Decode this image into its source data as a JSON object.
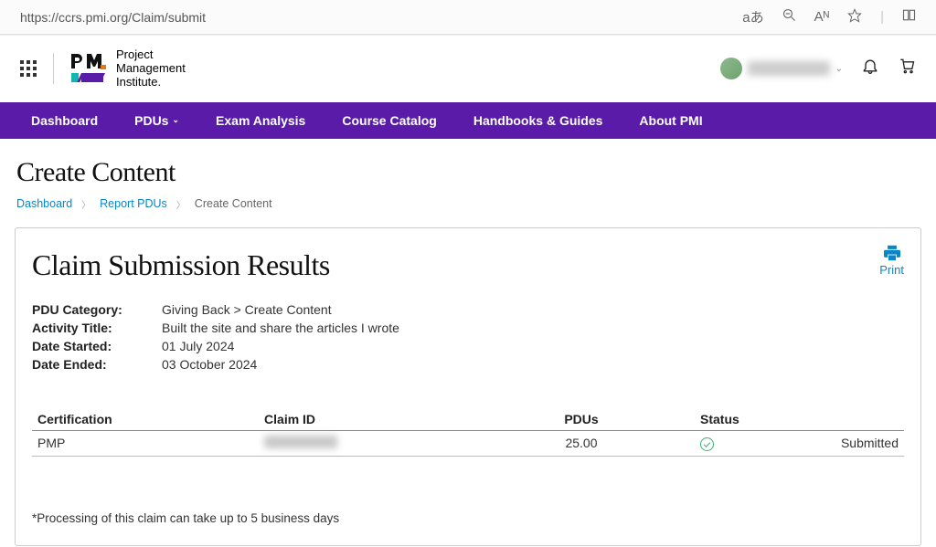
{
  "browser": {
    "url": "https://ccrs.pmi.org/Claim/submit",
    "icons": {
      "translate": "aあ",
      "zoom_out": "zoom-out",
      "text_size": "Aᴺ",
      "star": "star",
      "tab_actions": "tab-actions"
    }
  },
  "header": {
    "org_line1": "Project",
    "org_line2": "Management",
    "org_line3": "Institute.",
    "user_chevron": "⌄"
  },
  "nav": {
    "dashboard": "Dashboard",
    "pdus": "PDUs",
    "exam": "Exam Analysis",
    "catalog": "Course Catalog",
    "handbooks": "Handbooks & Guides",
    "about": "About PMI"
  },
  "page_title": "Create Content",
  "breadcrumbs": {
    "dashboard": "Dashboard",
    "report": "Report PDUs",
    "current": "Create Content"
  },
  "card": {
    "title": "Claim Submission Results",
    "print": "Print",
    "details": {
      "pdu_category_label": "PDU Category:",
      "pdu_category_value": "Giving Back > Create Content",
      "activity_title_label": "Activity Title:",
      "activity_title_value": "Built the site and share the articles I wrote",
      "date_started_label": "Date Started:",
      "date_started_value": "01 July 2024",
      "date_ended_label": "Date Ended:",
      "date_ended_value": "03 October 2024"
    },
    "table": {
      "headers": {
        "certification": "Certification",
        "claim_id": "Claim ID",
        "pdus": "PDUs",
        "status": "Status"
      },
      "row": {
        "certification": "PMP",
        "claim_id": "",
        "pdus": "25.00",
        "status": "Submitted"
      }
    },
    "footnote": "*Processing of this claim can take up to 5 business days"
  }
}
